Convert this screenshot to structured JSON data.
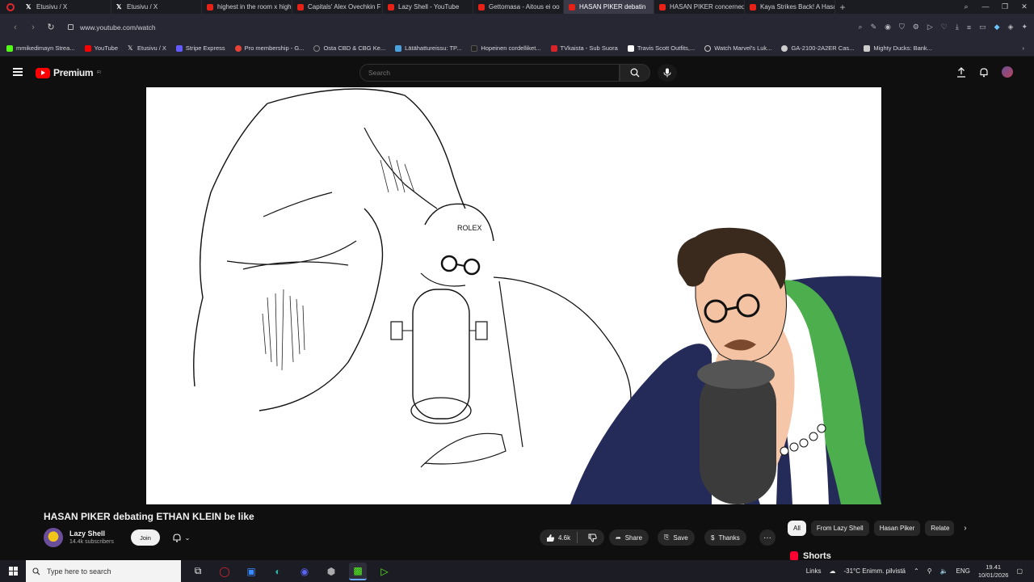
{
  "browser": {
    "tabs": [
      {
        "label": "Etusivu / X",
        "favicon": "x-icon",
        "active": false
      },
      {
        "label": "Etusivu / X",
        "favicon": "x-icon",
        "active": false
      },
      {
        "label": "highest in the room x high",
        "favicon": "youtube-icon",
        "active": false
      },
      {
        "label": "Capitals' Alex Ovechkin F",
        "favicon": "youtube-icon",
        "active": false
      },
      {
        "label": "Lazy Shell - YouTube",
        "favicon": "youtube-icon",
        "active": false
      },
      {
        "label": "Gettomasa - Aitous ei oo",
        "favicon": "youtube-icon",
        "active": false
      },
      {
        "label": "HASAN PIKER debatin",
        "favicon": "youtube-icon",
        "active": true
      },
      {
        "label": "HASAN PIKER concerned",
        "favicon": "youtube-icon",
        "active": false
      },
      {
        "label": "Kaya Strikes Back! A Hasa",
        "favicon": "youtube-icon",
        "active": false
      }
    ],
    "new_tab_label": "+",
    "url": "www.youtube.com/watch",
    "bookmarks": [
      {
        "label": "mmikedimayn Strea...",
        "color": "#53fc18"
      },
      {
        "label": "YouTube",
        "color": "#ff0000"
      },
      {
        "label": "Etusivu / X",
        "color": "#000000"
      },
      {
        "label": "Stripe Express",
        "color": "#635bff"
      },
      {
        "label": "Pro membership - G...",
        "color": "#e94235"
      },
      {
        "label": "Osta CBD & CBG Ke...",
        "color": "#777777"
      },
      {
        "label": "Lätähattureissu: TP...",
        "color": "#4aa3df"
      },
      {
        "label": "Hopeinen cordelliket...",
        "color": "#222222"
      },
      {
        "label": "TVkaista - Sub Suora",
        "color": "#d8232a"
      },
      {
        "label": "Travis Scott Outfits,...",
        "color": "#ffffff"
      },
      {
        "label": "Watch Marvel's Luk...",
        "color": "#cccccc"
      },
      {
        "label": "GA-2100-2A2ER Cas...",
        "color": "#cccccc"
      },
      {
        "label": "Mighty Ducks: Bank...",
        "color": "#cccccc"
      }
    ]
  },
  "youtube": {
    "logo_text": "Premium",
    "logo_sup": "FI",
    "search_placeholder": "Search",
    "video_title": "HASAN PIKER debating ETHAN KLEIN be like",
    "channel_name": "Lazy Shell",
    "subscribers": "14.4k subscribers",
    "join_label": "Join",
    "like_count": "4.6k",
    "share_label": "Share",
    "save_label": "Save",
    "thanks_label": "Thanks",
    "more_label": "···",
    "chips": [
      "All",
      "From Lazy Shell",
      "Hasan Piker",
      "Relate"
    ],
    "shorts_label": "Shorts"
  },
  "taskbar": {
    "search_placeholder": "Type here to search",
    "links_label": "Links",
    "weather": "-31°C  Enimm. pilvistä",
    "language": "ENG",
    "time": "19.41",
    "date": "10/01/2026"
  },
  "colors": {
    "yt_red": "#ff0000",
    "page_bg": "#0f0f0f",
    "chip_bg": "#272727"
  }
}
